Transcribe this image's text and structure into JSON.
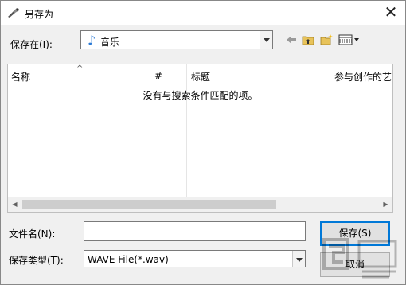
{
  "window": {
    "title": "另存为",
    "close_glyph": "✕"
  },
  "location": {
    "label": "保存在(I):",
    "value": "音乐",
    "icon": "music-note-icon"
  },
  "toolbar": {
    "back_icon": "back-arrow-icon",
    "up_icon": "up-folder-icon",
    "new_folder_icon": "new-folder-icon",
    "view_menu_icon": "view-menu-icon"
  },
  "list": {
    "columns": [
      {
        "label": "名称"
      },
      {
        "label": "#"
      },
      {
        "label": "标题"
      },
      {
        "label": "参与创作的艺术"
      }
    ],
    "empty_message": "没有与搜索条件匹配的项。"
  },
  "filename": {
    "label": "文件名(N):",
    "value": ""
  },
  "filetype": {
    "label": "保存类型(T):",
    "value": "WAVE File(*.wav)"
  },
  "buttons": {
    "save": "保存(S)",
    "cancel": "取消"
  }
}
